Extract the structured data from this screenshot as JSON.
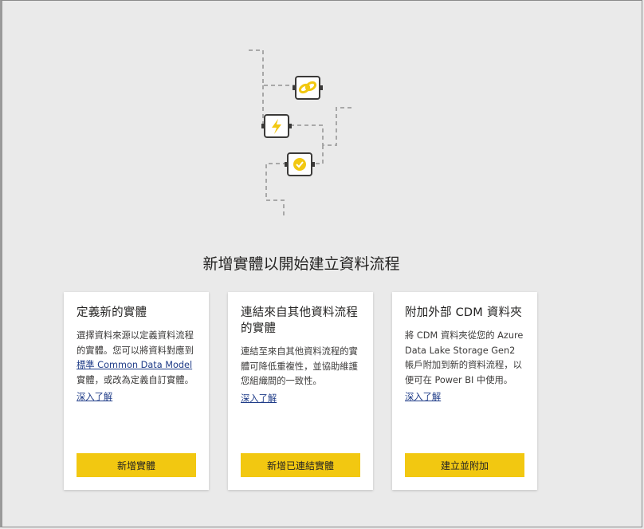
{
  "headline": "新增實體以開始建立資料流程",
  "illustration": {
    "icons": [
      "link-icon",
      "lightning-icon",
      "checkmark-badge-icon"
    ],
    "accent_color": "#f2c811",
    "line_color": "#a8a8a8"
  },
  "cards": [
    {
      "title": "定義新的實體",
      "desc_before_link": "選擇資料來源以定義資料流程的實體。您可以將資料對應到",
      "desc_link": "標準 Common Data Model",
      "desc_after_link": "實體，或改為定義自訂實體。",
      "learn_more": "深入了解",
      "button": "新增實體"
    },
    {
      "title": "連結來自其他資料流程的實體",
      "desc": "連結至來自其他資料流程的實體可降低重複性，並協助維護您組織間的一致性。",
      "learn_more": "深入了解",
      "button": "新增已連結實體"
    },
    {
      "title": "附加外部 CDM 資料夾",
      "desc": "將 CDM 資料夾從您的 Azure Data Lake Storage Gen2 帳戶附加到新的資料流程，以便可在 Power BI 中使用。",
      "learn_more": "深入了解",
      "button": "建立並附加"
    }
  ],
  "colors": {
    "background": "#eaeaea",
    "button": "#f2c811",
    "link": "#1f3c88"
  }
}
